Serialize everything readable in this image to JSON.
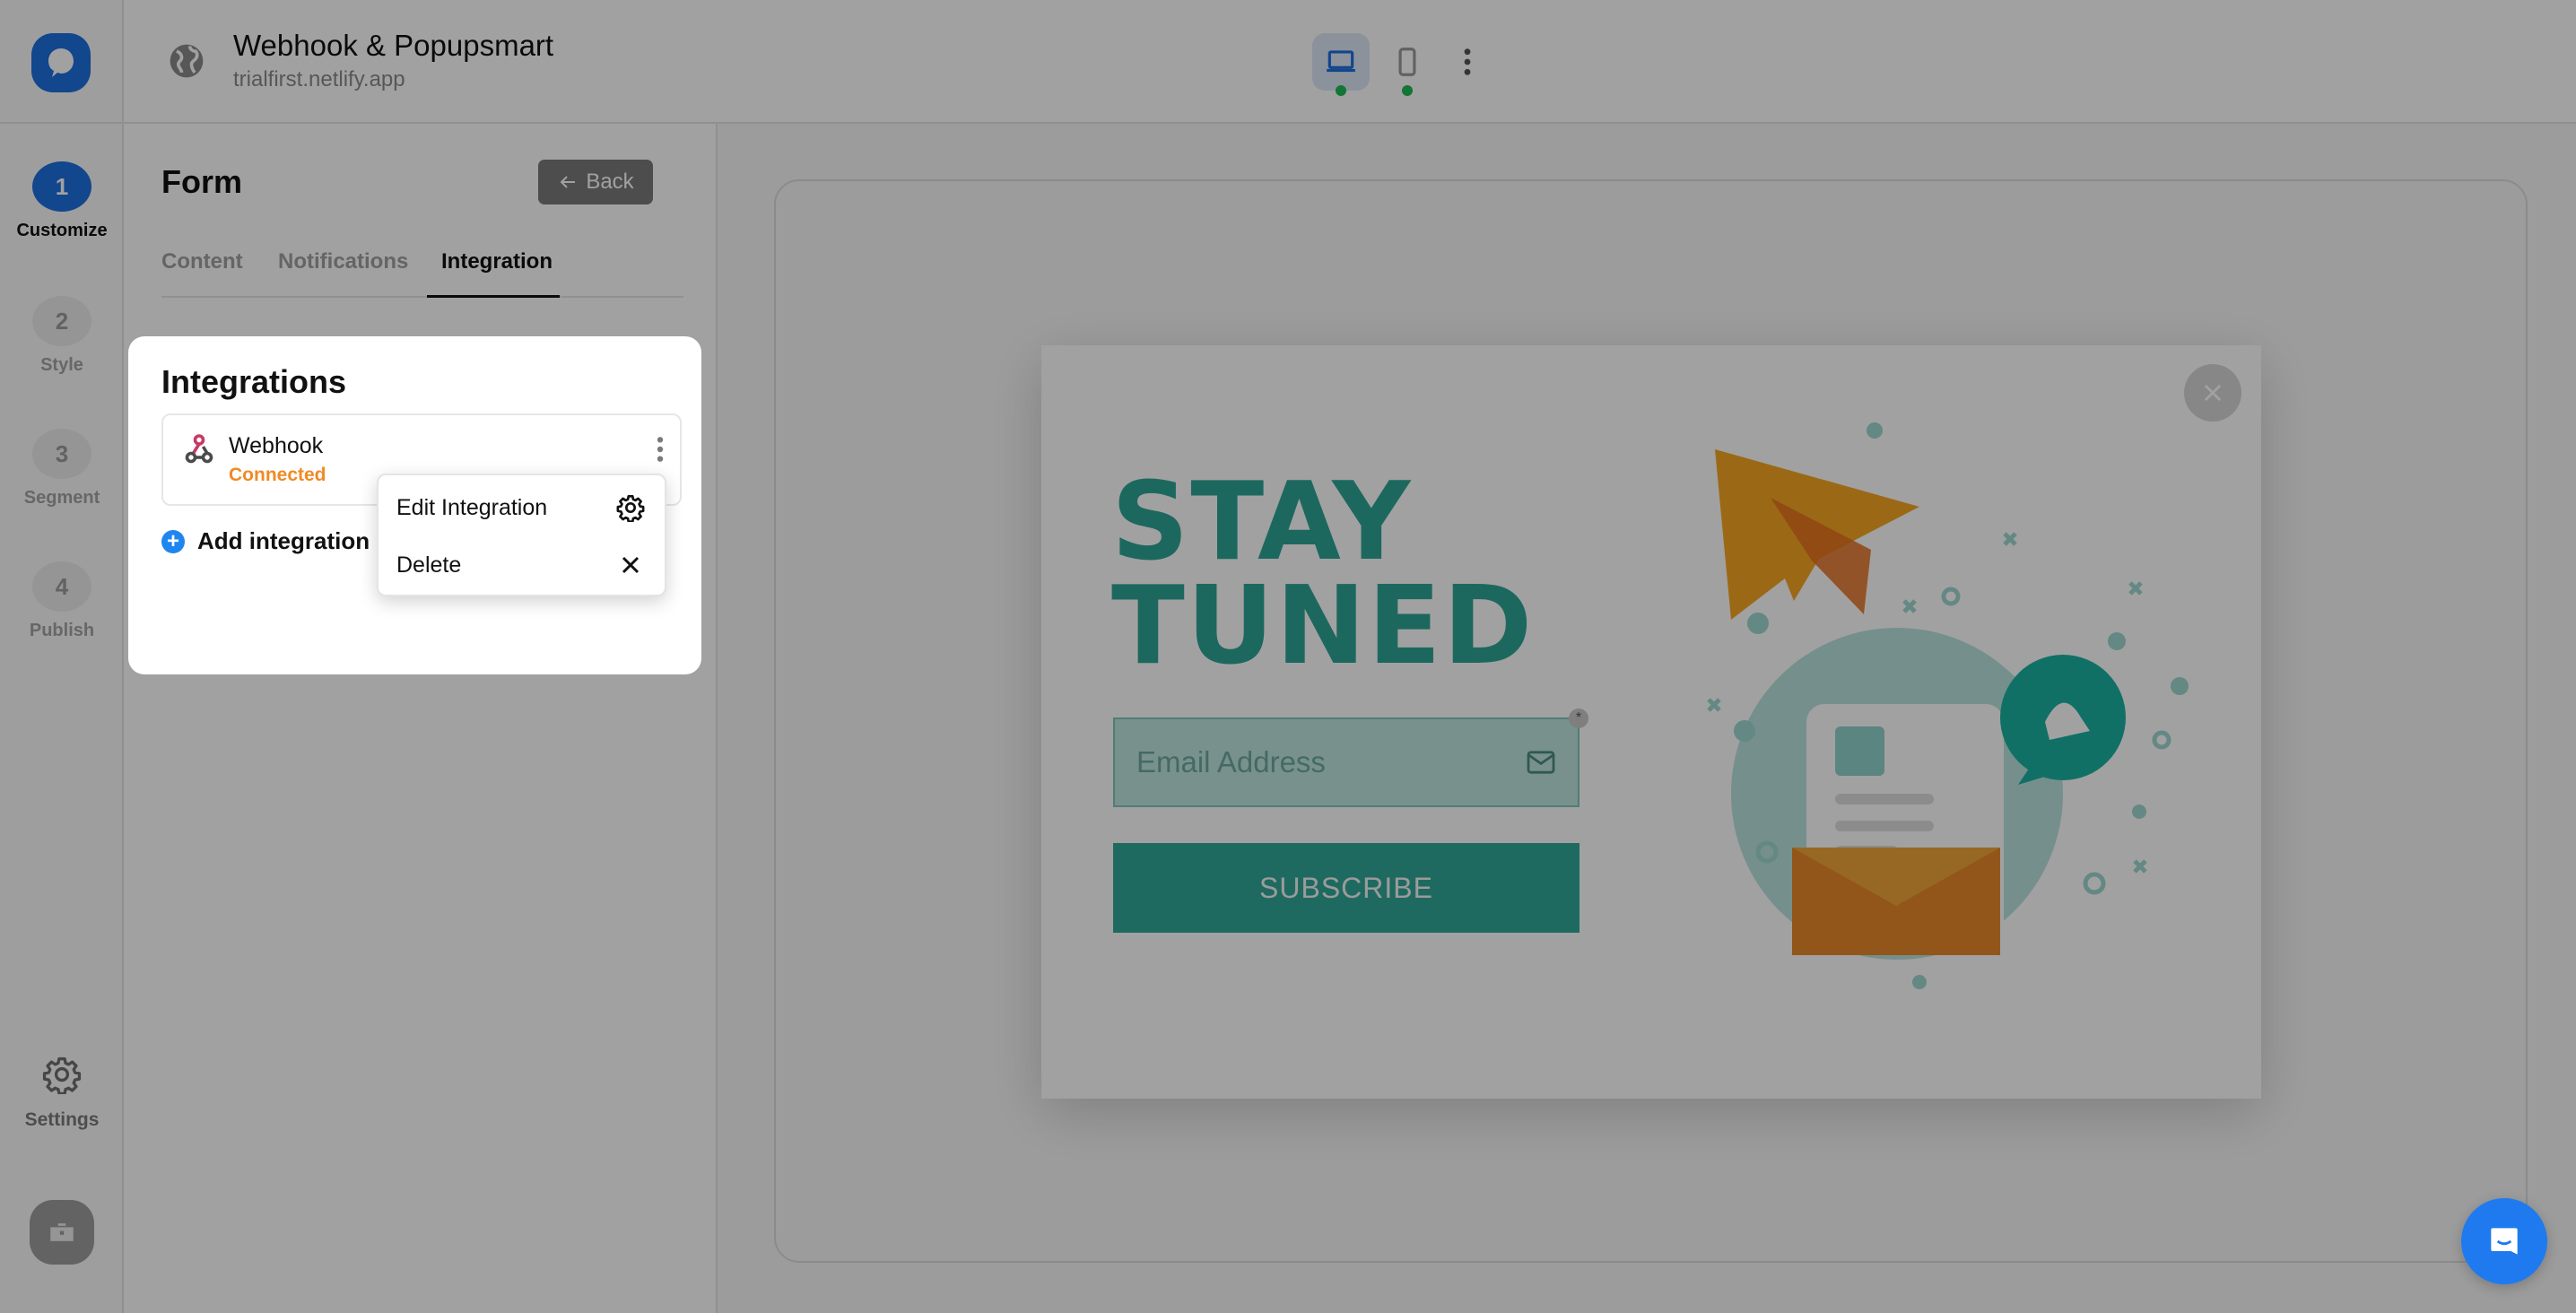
{
  "header": {
    "site_title": "Webhook & Popupsmart",
    "site_url": "trialfirst.netlify.app",
    "devices": [
      {
        "name": "desktop",
        "active": true,
        "status": "green"
      },
      {
        "name": "mobile",
        "active": false,
        "status": "green"
      }
    ]
  },
  "rail": {
    "steps": [
      {
        "number": "1",
        "label": "Customize",
        "active": true
      },
      {
        "number": "2",
        "label": "Style",
        "active": false
      },
      {
        "number": "3",
        "label": "Segment",
        "active": false
      },
      {
        "number": "4",
        "label": "Publish",
        "active": false
      }
    ],
    "settings_label": "Settings"
  },
  "panel": {
    "title": "Form",
    "back_label": "Back",
    "tabs": [
      {
        "label": "Content",
        "active": false
      },
      {
        "label": "Notifications",
        "active": false
      },
      {
        "label": "Integration",
        "active": true
      }
    ]
  },
  "integrations": {
    "title": "Integrations",
    "items": [
      {
        "name": "Webhook",
        "status": "Connected",
        "icon": "webhook-icon"
      }
    ],
    "add_label": "Add integration",
    "menu": [
      {
        "label": "Edit Integration",
        "icon": "gear-icon"
      },
      {
        "label": "Delete",
        "icon": "close-icon"
      }
    ]
  },
  "popup": {
    "headline_line1": "STAY",
    "headline_line2": "TUNED",
    "email_placeholder": "Email Address",
    "email_value": "",
    "required_marker": "*",
    "subscribe_label": "SUBSCRIBE"
  },
  "colors": {
    "brand_blue": "#1d6fe0",
    "popup_teal": "#2fa596",
    "status_connected": "#f08a24",
    "overlay": "rgba(0,0,0,0.37)"
  }
}
